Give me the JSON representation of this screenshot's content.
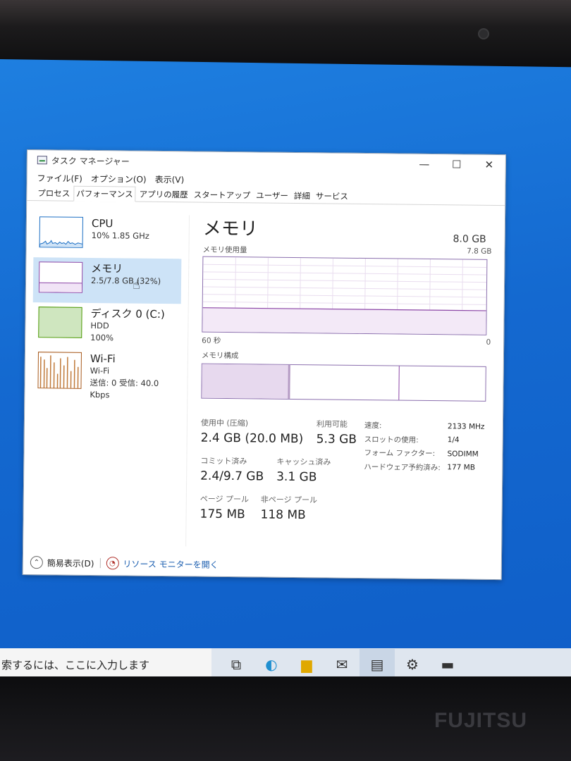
{
  "window": {
    "title": "タスク マネージャー",
    "controls": {
      "minimize": "—",
      "maximize": "☐",
      "close": "✕"
    }
  },
  "menu": [
    "ファイル(F)",
    "オプション(O)",
    "表示(V)"
  ],
  "tabs": [
    "プロセス",
    "パフォーマンス",
    "アプリの履歴",
    "スタートアップ",
    "ユーザー",
    "詳細",
    "サービス"
  ],
  "selected_tab": "パフォーマンス",
  "resources": [
    {
      "name": "CPU",
      "sub1": "10%  1.85 GHz",
      "sub2": "",
      "sub3": "",
      "color": "#1c6fc4"
    },
    {
      "name": "メモリ",
      "sub1": "2.5/7.8 GB (32%)",
      "sub2": "",
      "sub3": "",
      "color": "#8b45a6"
    },
    {
      "name": "ディスク 0 (C:)",
      "sub1": "HDD",
      "sub2": "100%",
      "sub3": "",
      "color": "#4e9a06"
    },
    {
      "name": "Wi-Fi",
      "sub1": "Wi-Fi",
      "sub2": "送信: 0  受信: 40.0 Kbps",
      "sub3": "",
      "color": "#a7581a"
    }
  ],
  "main": {
    "title": "メモリ",
    "capacity": "8.0 GB",
    "usage_label": "メモリ使用量",
    "usage_max": "7.8 GB",
    "time_left": "60 秒",
    "time_right": "0",
    "composition_label": "メモリ構成",
    "usage_fraction": 0.32
  },
  "stats": {
    "in_use_label": "使用中 (圧縮)",
    "in_use_value": "2.4 GB (20.0 MB)",
    "available_label": "利用可能",
    "available_value": "5.3 GB",
    "committed_label": "コミット済み",
    "committed_value": "2.4/9.7 GB",
    "cached_label": "キャッシュ済み",
    "cached_value": "3.1 GB",
    "paged_label": "ページ プール",
    "paged_value": "175 MB",
    "nonpaged_label": "非ページ プール",
    "nonpaged_value": "118 MB"
  },
  "specs": [
    {
      "key": "速度:",
      "value": "2133 MHz"
    },
    {
      "key": "スロットの使用:",
      "value": "1/4"
    },
    {
      "key": "フォーム ファクター:",
      "value": "SODIMM"
    },
    {
      "key": "ハードウェア予約済み:",
      "value": "177 MB"
    }
  ],
  "footer": {
    "fewer_details": "簡易表示(D)",
    "resource_monitor": "リソース モニターを開く"
  },
  "taskbar": {
    "search_text": "索するには、ここに入力します",
    "icons": [
      "task-view-icon",
      "edge-icon",
      "file-explorer-icon",
      "mail-icon",
      "task-manager-icon",
      "settings-icon",
      "terminal-icon"
    ]
  },
  "brand": "FUJITSU",
  "colors": {
    "memory": "#8b45a6",
    "cpu": "#1c6fc4",
    "disk": "#4e9a06",
    "wifi": "#a7581a",
    "selection": "#cde3f7"
  }
}
